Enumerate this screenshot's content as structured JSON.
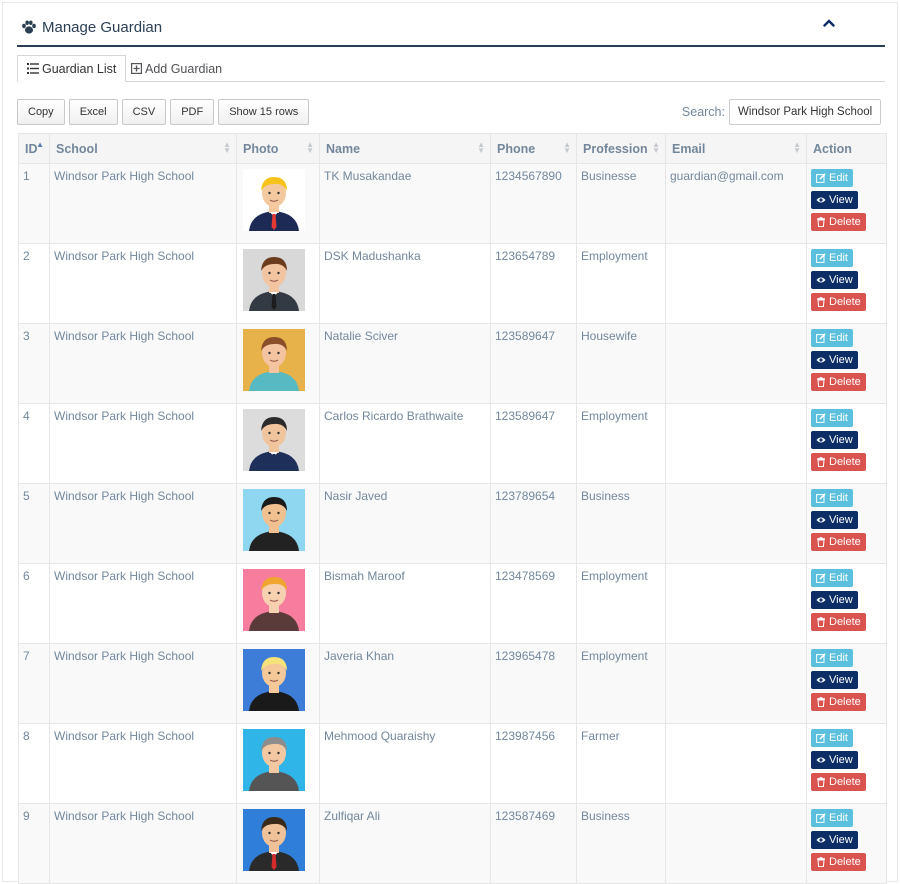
{
  "header": {
    "title": "Manage Guardian"
  },
  "tabs": [
    {
      "label": "Guardian List"
    },
    {
      "label": "Add Guardian"
    }
  ],
  "toolbar": {
    "copy": "Copy",
    "excel": "Excel",
    "csv": "CSV",
    "pdf": "PDF",
    "rows": "Show 15 rows"
  },
  "search": {
    "label": "Search:",
    "value": "Windsor Park High School"
  },
  "columns": [
    "ID",
    "School",
    "Photo",
    "Name",
    "Phone",
    "Profession",
    "Email",
    "Action"
  ],
  "actions": {
    "edit": "Edit",
    "view": "View",
    "delete": "Delete"
  },
  "rows": [
    {
      "id": "1",
      "school": "Windsor Park High School",
      "name": "TK Musakandae",
      "phone": "1234567890",
      "profession": "Businesse",
      "email": "guardian@gmail.com",
      "avatar": {
        "bg": "#ffffff",
        "hair": "#f7c31a",
        "skin": "#f5c9a0",
        "suit": "#1c2a55",
        "tie": "#e53935"
      }
    },
    {
      "id": "2",
      "school": "Windsor Park High School",
      "name": "DSK Madushanka",
      "phone": "123654789",
      "profession": "Employment",
      "email": "",
      "avatar": {
        "bg": "#d8d8d8",
        "hair": "#6b3b1e",
        "skin": "#f2c4a0",
        "suit": "#333a44",
        "tie": "#1d1d1d"
      }
    },
    {
      "id": "3",
      "school": "Windsor Park High School",
      "name": "Natalie Sciver",
      "phone": "123589647",
      "profession": "Housewife",
      "email": "",
      "avatar": {
        "bg": "#e8b24a",
        "hair": "#8a4f28",
        "skin": "#f4c3a0",
        "suit": "#57b9c2",
        "tie": ""
      }
    },
    {
      "id": "4",
      "school": "Windsor Park High School",
      "name": "Carlos Ricardo Brathwaite",
      "phone": "123589647",
      "profession": "Employment",
      "email": "",
      "avatar": {
        "bg": "#dcdcdc",
        "hair": "#2b2b2b",
        "skin": "#f0c49c",
        "suit": "#1e2f5a",
        "tie": "#1e2f5a"
      }
    },
    {
      "id": "5",
      "school": "Windsor Park High School",
      "name": "Nasir Javed",
      "phone": "123789654",
      "profession": "Business",
      "email": "",
      "avatar": {
        "bg": "#8fd6f0",
        "hair": "#1a1a1a",
        "skin": "#f0c090",
        "suit": "#222222",
        "tie": ""
      }
    },
    {
      "id": "6",
      "school": "Windsor Park High School",
      "name": "Bismah Maroof",
      "phone": "123478569",
      "profession": "Employment",
      "email": "",
      "avatar": {
        "bg": "#f77d9e",
        "hair": "#f0a62e",
        "skin": "#f7d0b0",
        "suit": "#5b3a3a",
        "tie": ""
      }
    },
    {
      "id": "7",
      "school": "Windsor Park High School",
      "name": "Javeria Khan",
      "phone": "123965478",
      "profession": "Employment",
      "email": "",
      "avatar": {
        "bg": "#3d7dd8",
        "hair": "#f6e27a",
        "skin": "#f5c89a",
        "suit": "#1a1a1a",
        "tie": ""
      }
    },
    {
      "id": "8",
      "school": "Windsor Park High School",
      "name": "Mehmood Quaraishy",
      "phone": "123987456",
      "profession": "Farmer",
      "email": "",
      "avatar": {
        "bg": "#2fb5e8",
        "hair": "#8d8d8d",
        "skin": "#f2c8a2",
        "suit": "#555555",
        "tie": ""
      }
    },
    {
      "id": "9",
      "school": "Windsor Park High School",
      "name": "Zulfiqar Ali",
      "phone": "123587469",
      "profession": "Business",
      "email": "",
      "avatar": {
        "bg": "#2f7fd8",
        "hair": "#3a2a1a",
        "skin": "#f0c29a",
        "suit": "#2a2a2a",
        "tie": "#d62b2b"
      }
    }
  ]
}
